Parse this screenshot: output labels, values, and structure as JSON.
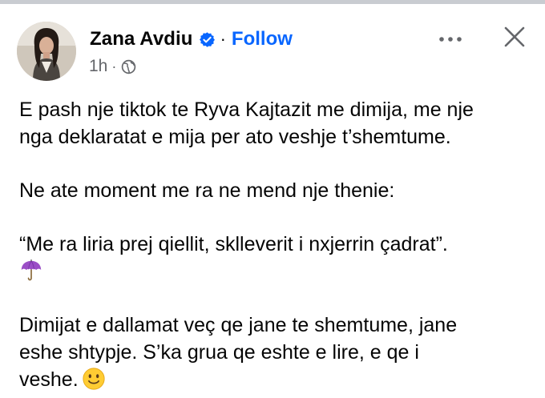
{
  "post": {
    "author": {
      "name": "Zana Avdiu",
      "verified": true,
      "follow_label": "Follow",
      "avatar_icon": "profile-photo"
    },
    "meta": {
      "time": "1h",
      "separator": "·",
      "privacy_icon": "globe-icon"
    },
    "separator": "·",
    "actions": {
      "more_icon": "more-horizontal-icon",
      "close_icon": "close-icon"
    },
    "paragraphs": {
      "p1_line1": "E pash nje tiktok te Ryva Kajtazit me dimija, me nje",
      "p1_line2": "nga deklaratat e mija per ato veshje t’shemtume.",
      "p2": "Ne ate moment me ra ne mend nje thenie:",
      "p3": "“Me ra liria prej qiellit, sklleverit i nxjerrin çadrat”.",
      "p3_emoji": "umbrella-emoji",
      "p4_line1": "Dimijat e dallamat veç qe jane te shemtume, jane",
      "p4_line2": "eshe shtypje. S’ka grua qe eshte e lire, e qe i",
      "p4_line3": "veshe.",
      "p4_emoji": "slightly-smiling-face-emoji"
    },
    "colors": {
      "follow": "#0866ff",
      "verified": "#0866ff",
      "meta": "#65676b",
      "text": "#050505"
    }
  }
}
